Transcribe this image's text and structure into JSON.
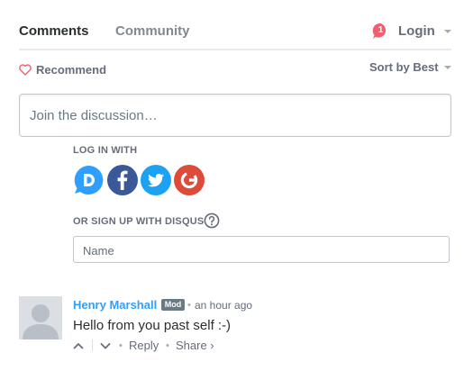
{
  "nav": {
    "tabs": [
      {
        "label": "Comments",
        "active": true
      },
      {
        "label": "Community",
        "active": false
      }
    ],
    "notification_count": "1",
    "login_label": "Login"
  },
  "toolbar": {
    "recommend_label": "Recommend",
    "sort_label": "Sort by Best"
  },
  "composer": {
    "placeholder": "Join the discussion…",
    "login_with_label": "LOG IN WITH",
    "social_logins": [
      "disqus-icon",
      "facebook-icon",
      "twitter-icon",
      "google-icon"
    ],
    "signup_label": "OR SIGN UP WITH DISQUS",
    "name_placeholder": "Name"
  },
  "comments": [
    {
      "author": "Henry Marshall",
      "badge": "Mod",
      "timestamp": "an hour ago",
      "message": "Hello from you past self :-)",
      "reply_label": "Reply",
      "share_label": "Share ›"
    }
  ],
  "colors": {
    "accent": "#2e9fff",
    "notification": "#f05f70",
    "text": "#2a2e2e",
    "muted": "#656c7a",
    "facebook": "#3b5998",
    "twitter": "#1da1f2",
    "google": "#dd4b39",
    "disqus": "#2e9fff"
  }
}
